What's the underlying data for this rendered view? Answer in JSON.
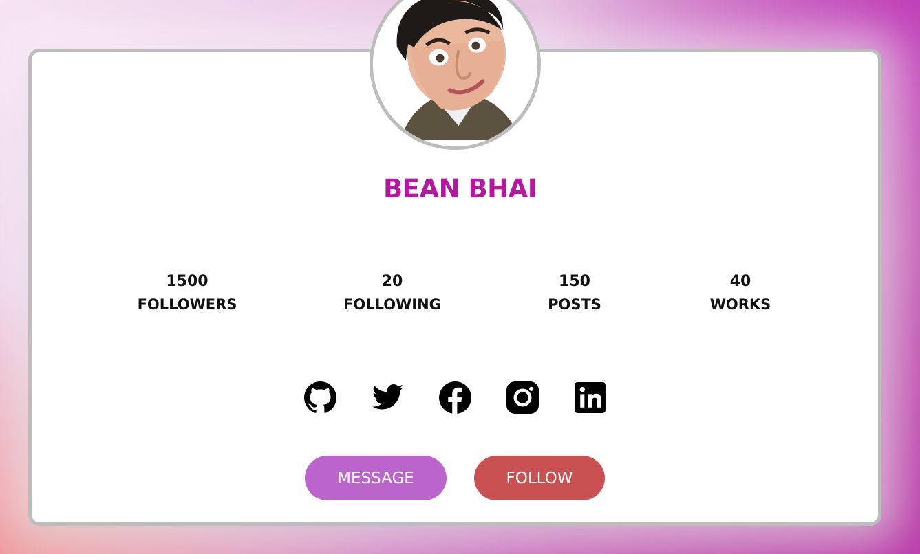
{
  "profile": {
    "name": "BEAN BHAI"
  },
  "stats": [
    {
      "value": "1500",
      "label": "FOLLOWERS"
    },
    {
      "value": "20",
      "label": "FOLLOWING"
    },
    {
      "value": "150",
      "label": "POSTS"
    },
    {
      "value": "40",
      "label": "WORKS"
    }
  ],
  "socials": [
    "github-icon",
    "twitter-icon",
    "facebook-icon",
    "instagram-icon",
    "linkedin-icon"
  ],
  "buttons": {
    "message_label": "MESSAGE",
    "follow_label": "FOLLOW"
  },
  "colors": {
    "name": "#b5179e",
    "message_button": "#bb64cc",
    "follow_button": "#c95152",
    "card_border": "#bdbdbd"
  }
}
